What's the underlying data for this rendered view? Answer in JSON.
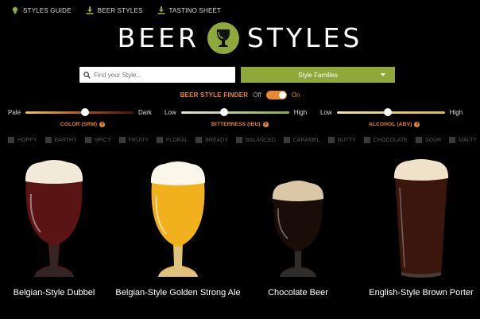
{
  "topnav": [
    {
      "label": "STYLES GUIDE",
      "icon": "lightbulb-icon"
    },
    {
      "label": "BEER STYLES",
      "icon": "download-icon"
    },
    {
      "label": "TASTINO SHEET",
      "icon": "download-icon"
    }
  ],
  "logo": {
    "left_word": "BEER",
    "right_word": "STYLES",
    "icon": "beer-glass-icon",
    "accent": "#8fa83a"
  },
  "search": {
    "placeholder": "Find your Style...",
    "value": ""
  },
  "families": {
    "label": "Style Families"
  },
  "finder": {
    "label": "BEER STYLE FINDER",
    "off": "Off",
    "on": "On",
    "enabled": true
  },
  "sliders": [
    {
      "left": "Pale",
      "right": "Dark",
      "title": "COLOR (SRM)",
      "level": 0.55
    },
    {
      "left": "Low",
      "right": "High",
      "title": "BITTERNESS (IBU)",
      "level": 0.4
    },
    {
      "left": "Low",
      "right": "High",
      "title": "ALCOHOL (ABV)",
      "level": 0.47
    }
  ],
  "flavors": [
    "HOPPY",
    "EARTHY",
    "SPICY",
    "FRUITY",
    "FLORAL",
    "BREADY",
    "BALANCED",
    "CARAMEL",
    "NUTTY",
    "CHOCOLATE",
    "SOUR",
    "MALTY"
  ],
  "beers": [
    {
      "name": "Belgian-Style Dubbel",
      "color": "#5a1414"
    },
    {
      "name": "Belgian-Style Golden Strong Ale",
      "color": "#f0b11c"
    },
    {
      "name": "Chocolate Beer",
      "color": "#1a0c06"
    },
    {
      "name": "English-Style Brown Porter",
      "color": "#3a160c"
    }
  ],
  "colors": {
    "accent": "#e8882c",
    "green": "#8fa83a"
  }
}
